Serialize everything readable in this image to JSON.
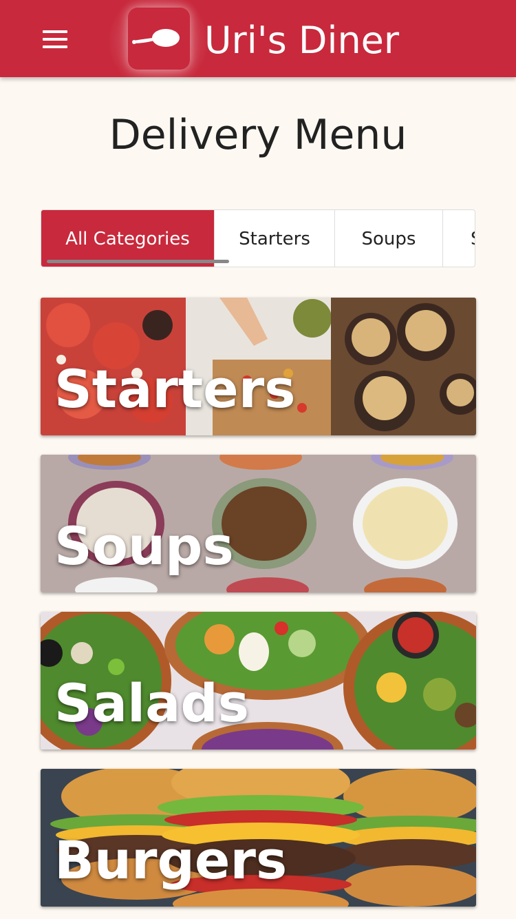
{
  "header": {
    "brand": "Uri's Diner",
    "menu_icon": "hamburger-menu-icon",
    "logo_icon": "spoon-icon"
  },
  "page": {
    "title": "Delivery Menu"
  },
  "tabs": [
    {
      "label": "All Categories",
      "active": true
    },
    {
      "label": "Starters",
      "active": false
    },
    {
      "label": "Soups",
      "active": false
    },
    {
      "label": "S",
      "active": false
    }
  ],
  "categories": [
    {
      "label": "Starters"
    },
    {
      "label": "Soups"
    },
    {
      "label": "Salads"
    },
    {
      "label": "Burgers"
    }
  ],
  "colors": {
    "brand": "#c8293c",
    "background": "#fdf8f2"
  }
}
